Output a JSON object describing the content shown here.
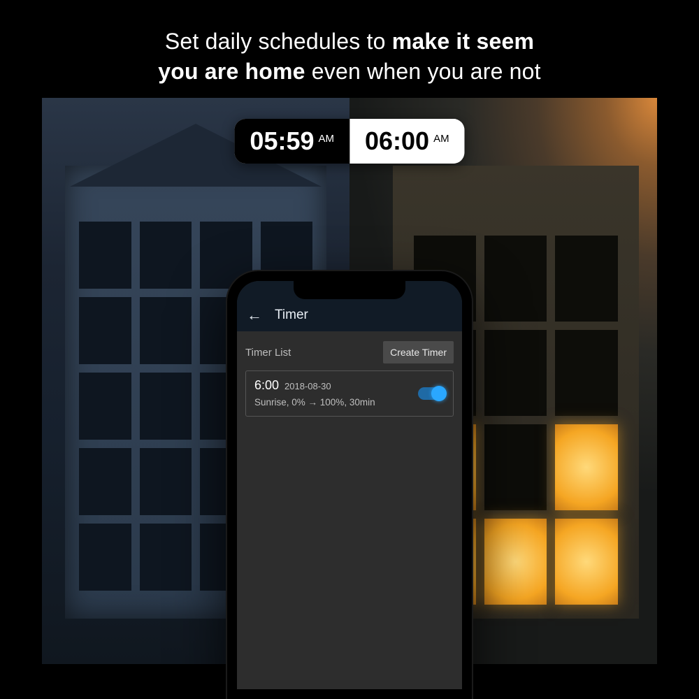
{
  "headline": {
    "part1": "Set daily schedules to ",
    "bold1": "make it seem",
    "bold2": "you are home",
    "part2": " even when you are not"
  },
  "time_pill": {
    "left_time": "05:59",
    "left_ampm": "AM",
    "right_time": "06:00",
    "right_ampm": "AM"
  },
  "app": {
    "title": "Timer",
    "list_title": "Timer List",
    "create_button": "Create Timer",
    "timer": {
      "time": "6:00",
      "date": "2018-08-30",
      "desc": "Sunrise, 0% → 100%, 30min",
      "enabled": true
    }
  }
}
